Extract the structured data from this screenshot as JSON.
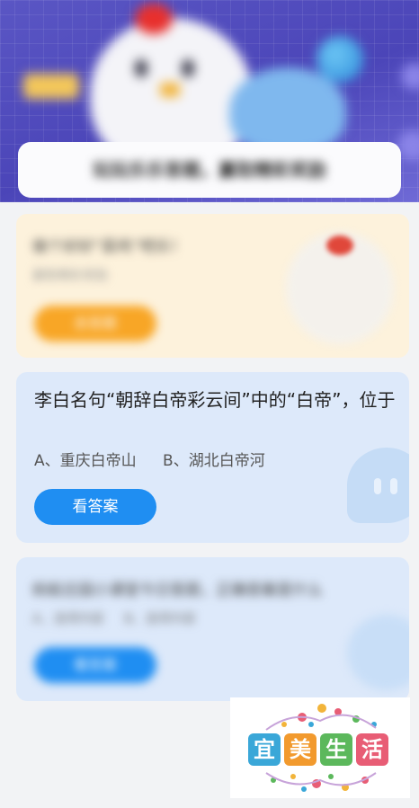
{
  "banner": {
    "text": "玩玩乐乐答题，赢取精彩奖励"
  },
  "promo_card": {
    "title": "做个好好“菜鸡”吧乐！",
    "subtitle": "赢取精彩奖励",
    "button_label": "去答题"
  },
  "question_card": {
    "question": "李白名句“朝辞白帝彩云间”中的“白帝”，位于",
    "options": [
      "A、重庆白帝山",
      "B、湖北白帝河"
    ],
    "button_label": "看答案"
  },
  "next_card": {
    "question": "蚂蚁庄园小课堂今日答题，正确答案是什么",
    "options": [
      "A、选项内容",
      "B、选项内容"
    ],
    "button_label": "看答案"
  },
  "watermark": {
    "characters": [
      "宜",
      "美",
      "生",
      "活"
    ],
    "colors": [
      "#3aa7d8",
      "#f29a2e",
      "#5cb85c",
      "#e85d75"
    ]
  },
  "colors": {
    "primary_button": "#1f8ef2",
    "promo_button": "#f8a626",
    "card_blue": "#dde9fa",
    "card_yellow": "#fdf2dc"
  }
}
